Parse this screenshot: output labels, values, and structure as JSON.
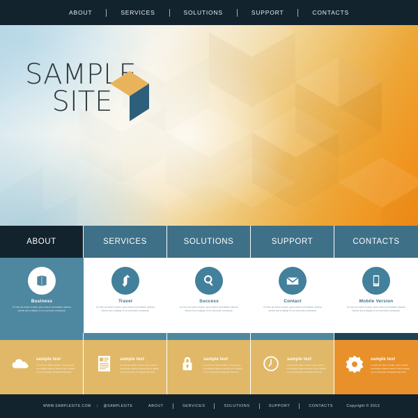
{
  "top_nav": {
    "items": [
      {
        "label": "ABOUT"
      },
      {
        "label": "SERVICES"
      },
      {
        "label": "SOLUTIONS"
      },
      {
        "label": "SUPPORT"
      },
      {
        "label": "CONTACTS"
      }
    ]
  },
  "hero": {
    "logo_line1": "SAMPLE",
    "logo_line2": "SITE",
    "logo_icon": "isometric-cube",
    "colors": {
      "cube_top": "#e8b котор",
      "cube_top_hex": "#e9b35c",
      "cube_side": "#2d5f7a",
      "gradient_left": "#c3dce8",
      "gradient_mid": "#f7f3e7",
      "gradient_right": "#f18a16"
    }
  },
  "main_nav": {
    "active": "ABOUT",
    "items": [
      {
        "label": "ABOUT",
        "active": true
      },
      {
        "label": "SERVICES",
        "active": false
      },
      {
        "label": "SOLUTIONS",
        "active": false
      },
      {
        "label": "SUPPORT",
        "active": false
      },
      {
        "label": "CONTACTS",
        "active": false
      }
    ],
    "colors": {
      "active_bg": "#13232e",
      "bg": "#3e7087",
      "text": "#ffffff"
    }
  },
  "features": {
    "body_text": "Ut enim ad minim veniam, quis nostrud exercitation ullamco laboris nisi ut aliquip ex ea commodo consequat.",
    "items": [
      {
        "title": "Business",
        "icon": "book-icon",
        "highlighted": true
      },
      {
        "title": "Travel",
        "icon": "exchange-arrows-icon",
        "highlighted": false
      },
      {
        "title": "Success",
        "icon": "magnifier-icon",
        "highlighted": false
      },
      {
        "title": "Contact",
        "icon": "envelope-icon",
        "highlighted": false
      },
      {
        "title": "Mobile Version",
        "icon": "smartphone-icon",
        "highlighted": false
      }
    ],
    "colors": {
      "circle": "#42809c",
      "highlight_bg": "#4e87a0",
      "title": "#3e7087"
    }
  },
  "gold_row": {
    "body_text": "Ut enim ad minim veniam, quis nostrud exercitation ullamco laboris nisi ut aliquip ex ea commodo consequat duis aute.",
    "items": [
      {
        "title": "sample text",
        "icon": "cloud-icon",
        "accent": false
      },
      {
        "title": "sample text",
        "icon": "document-icon",
        "accent": false
      },
      {
        "title": "sample text",
        "icon": "lock-icon",
        "accent": false
      },
      {
        "title": "sample text",
        "icon": "clock-icon",
        "accent": false
      },
      {
        "title": "sample text",
        "icon": "gear-icon",
        "accent": true
      }
    ],
    "colors": {
      "panel": "#e0b868",
      "accent_panel": "#e8912b",
      "strip": "#4e87a0",
      "accent_strip": "#1e4254"
    }
  },
  "footer": {
    "website": "WWW.SAMPLESITE.COM",
    "separator": "|",
    "social": "@SAMPLESITE",
    "nav": [
      {
        "label": "ABOUT"
      },
      {
        "label": "SERVICES"
      },
      {
        "label": "SOLUTIONS"
      },
      {
        "label": "SUPPORT"
      },
      {
        "label": "CONTACTS"
      }
    ],
    "copyright": "Copyright © 2013",
    "colors": {
      "bg": "#13232e",
      "text": "#c3ced5"
    }
  }
}
